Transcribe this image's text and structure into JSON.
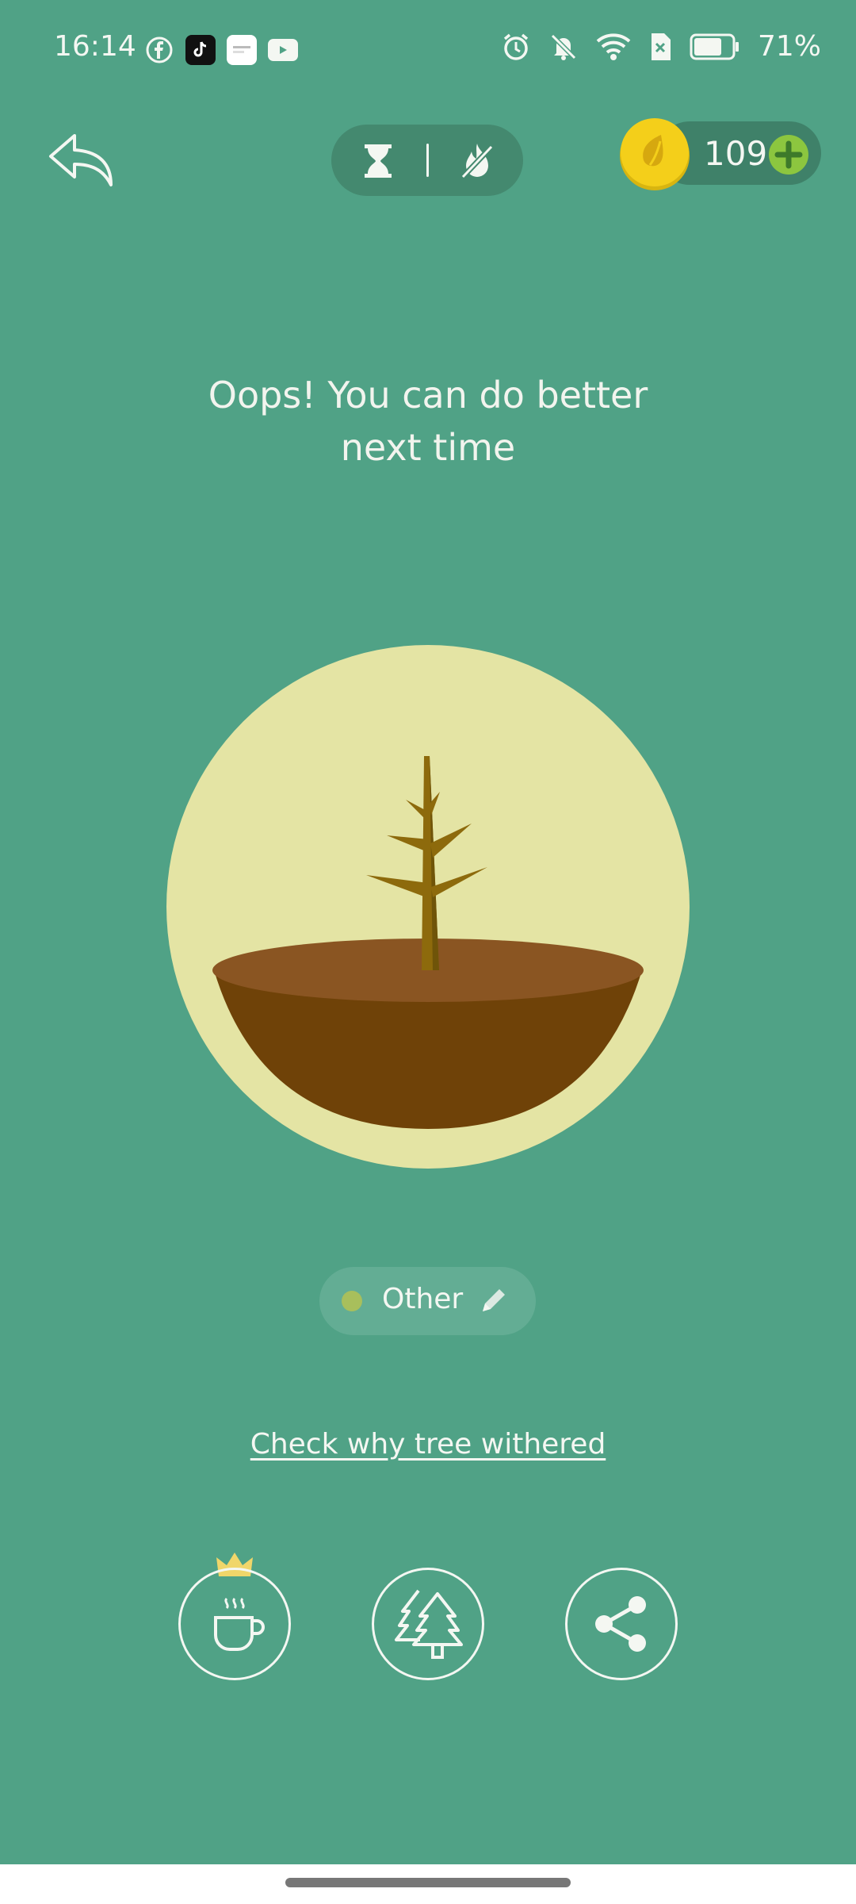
{
  "status_bar": {
    "time": "16:14",
    "battery": "71%",
    "app_icons": [
      "facebook-icon",
      "tiktok-icon",
      "notification-card-icon",
      "youtube-icon"
    ],
    "system_icons": [
      "alarm-icon",
      "mute-bell-icon",
      "wifi-icon",
      "sim-off-icon",
      "battery-icon"
    ]
  },
  "header": {
    "back_icon": "back-arrow-icon",
    "mode_icons": [
      "hourglass-icon",
      "flame-icon"
    ],
    "coins": "109",
    "add_icon": "plus-icon"
  },
  "main": {
    "headline_line1": "Oops! You can do better",
    "headline_line2": "next time",
    "tree_state": "withered"
  },
  "tag": {
    "label": "Other",
    "dot_color": "#a8bf5c"
  },
  "link": {
    "text": "Check why tree withered"
  },
  "actions": [
    {
      "name": "break-coffee-button",
      "icon": "coffee-cup-icon",
      "premium": true
    },
    {
      "name": "plant-together-button",
      "icon": "trees-icon"
    },
    {
      "name": "share-button",
      "icon": "share-icon"
    }
  ],
  "colors": {
    "background": "#50a286",
    "circle": "#e4e4a4",
    "soil_top": "#8a5522",
    "soil_bowl": "#6f4208",
    "trunk": "#8d6a0c",
    "coin": "#f4cf1a",
    "add_green": "#8cc63f"
  }
}
